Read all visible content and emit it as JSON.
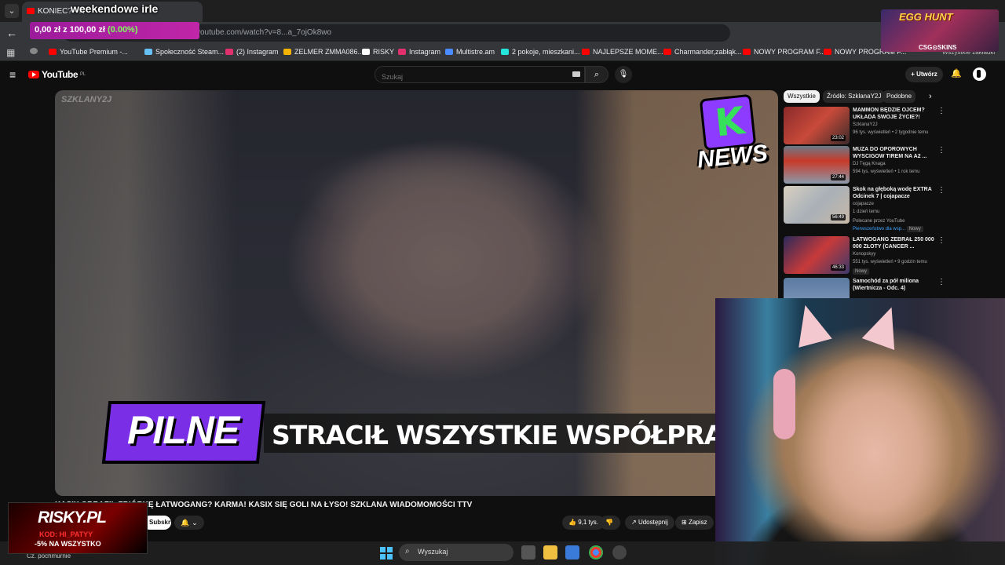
{
  "browser": {
    "tab_title": "KONIEC? - N",
    "url": "youtube.com/watch?v=8...a_7ojOk8wo",
    "bookmarks": [
      {
        "label": "YouTube Premium -...",
        "color": "#ff0000"
      },
      {
        "label": "Społeczność Steam...",
        "color": "#66c0f4"
      },
      {
        "label": "(2) Instagram",
        "color": "#e1306c"
      },
      {
        "label": "ZELMER ZMMA086...",
        "color": "#f5b400"
      },
      {
        "label": "RISKY",
        "color": "#ffffff"
      },
      {
        "label": "Instagram",
        "color": "#e1306c"
      },
      {
        "label": "Multistre.am",
        "color": "#4a8cff"
      },
      {
        "label": "2 pokoje, mieszkani...",
        "color": "#23e5db"
      },
      {
        "label": "NAJLEPSZE MOME...",
        "color": "#ff0000"
      },
      {
        "label": "Charmander,zabłąk...",
        "color": "#ff0000"
      },
      {
        "label": "NOWY PROGRAM F...",
        "color": "#ff0000"
      },
      {
        "label": "NOWY PROGRAM F...",
        "color": "#ff0000"
      }
    ],
    "all_bookmarks": "Wszystkie zakładki"
  },
  "overlay": {
    "stream_title": "weekendowe irle",
    "donation": {
      "current": "0,00 zł",
      "separator": "z",
      "goal": "100,00 zł",
      "percent": "(0.00%)"
    },
    "egg_hunt": {
      "title": "EGG HUNT",
      "sponsor": "CSG⊙SKINS"
    },
    "risky": {
      "logo": "RISKY.PL",
      "code": "KOD: HI_PATYY",
      "discount": "-5% NA WSZYSTKO"
    }
  },
  "youtube": {
    "logo": "YouTube",
    "region": "PL",
    "search_placeholder": "Szukaj",
    "create_label": "Utwórz",
    "video": {
      "banner_badge": "PILNE",
      "banner_text": "STRACIŁ WSZYSTKIE WSPÓŁPRACE ZA WYPOW",
      "news_logo": "NEWS",
      "watermark": "SZKLANY2J",
      "title": "KASIX OBRAZIŁ ZBIÓRKĘ ŁATWOGANG? KARMA! KASIX SIĘ GOLI NA ŁYSO! SZKLANA WIADOMOMOŚCI TTV",
      "subscribe": "Subskrybuj",
      "likes": "9,1 tys.",
      "share": "Udostępnij",
      "save": "Zapisz"
    },
    "chips": [
      {
        "label": "Wszystkie",
        "active": true
      },
      {
        "label": "Źródło: SzklanaY2J",
        "active": false
      },
      {
        "label": "Podobne",
        "active": false
      }
    ],
    "recommendations": [
      {
        "title": "MAMMON BĘDZIE OJCEM? UKŁADA SWOJE ŻYCIE?! NOW...",
        "channel": "SzklanaY2J",
        "meta": "96 tys. wyświetleń • 2 tygodnie temu",
        "duration": "23:02",
        "extra": "",
        "thumb_color": "#8a2a2a"
      },
      {
        "title": "MUZA DO OPOROWYCH WYSCIGOW TIREM NA A2 ...",
        "channel": "DJ Tęgą Knaga",
        "meta": "594 tys. wyświetleń • 1 rok temu",
        "duration": "27:44",
        "extra": "",
        "thumb_color": "#6a7a8a"
      },
      {
        "title": "Skok na głęboką wodę EXTRA Odcinek 7 | cojapacze",
        "channel": "cojapacze",
        "meta": "1 dzień temu",
        "duration": "56:49",
        "extra": "Polecane przez YouTube",
        "thumb_color": "#c8c0b0"
      },
      {
        "title": "ŁATWOGANG ZEBRAŁ 250 000 000 ZŁOTY (CANCER ...",
        "channel": "Konopskyy",
        "meta": "551 tys. wyświetleń • 9 godzin temu",
        "duration": "46:33",
        "extra": "Nowy",
        "thumb_color": "#3a3a6a"
      },
      {
        "title": "Samochód za pół miliona (Wiertnicza - Odc. 4)",
        "channel": "",
        "meta": "",
        "duration": "",
        "extra": "",
        "thumb_color": "#5a7aa0"
      }
    ],
    "rec3_premium": "Pierwszeństwo dla wsp...",
    "rec3_new": "Nowy"
  },
  "taskbar": {
    "weather": "Cz. pochmurnie",
    "search_label": "Wyszukaj"
  },
  "colors": {
    "accent": "#ff0000",
    "donation": "#c026a8",
    "pilne": "#7a2ee6"
  }
}
